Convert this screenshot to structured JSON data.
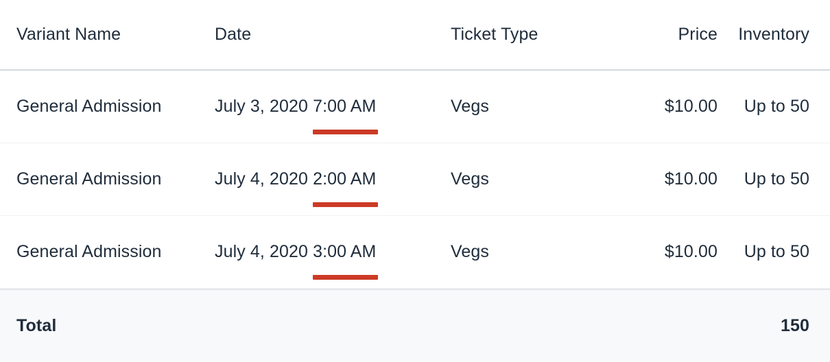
{
  "table": {
    "columns": [
      {
        "key": "variant_name",
        "label": "Variant Name",
        "align": "left"
      },
      {
        "key": "date",
        "label": "Date",
        "align": "left"
      },
      {
        "key": "ticket_type",
        "label": "Ticket Type",
        "align": "left"
      },
      {
        "key": "price",
        "label": "Price",
        "align": "right"
      },
      {
        "key": "inventory",
        "label": "Inventory",
        "align": "right"
      }
    ],
    "headers": {
      "variant_name": "Variant Name",
      "date": "Date",
      "ticket_type": "Ticket Type",
      "price": "Price",
      "inventory": "Inventory"
    },
    "rows": [
      {
        "variant_name": "General Admission",
        "date_day": "July 3, 2020 ",
        "date_time": "7:00 AM",
        "date_full": "July 3, 2020 7:00 AM",
        "ticket_type": "Vegs",
        "price": "$10.00",
        "inventory": "Up to 50",
        "time_highlighted": true
      },
      {
        "variant_name": "General Admission",
        "date_day": "July 4, 2020 ",
        "date_time": "2:00 AM",
        "date_full": "July 4, 2020 2:00 AM",
        "ticket_type": "Vegs",
        "price": "$10.00",
        "inventory": "Up to 50",
        "time_highlighted": true
      },
      {
        "variant_name": "General Admission",
        "date_day": "July 4, 2020 ",
        "date_time": "3:00 AM",
        "date_full": "July 4, 2020 3:00 AM",
        "ticket_type": "Vegs",
        "price": "$10.00",
        "inventory": "Up to 50",
        "time_highlighted": true
      }
    ],
    "footer": {
      "label": "Total",
      "value": "150"
    }
  },
  "colors": {
    "text": "#202d3c",
    "highlight_underline": "#cc3a26",
    "header_rule": "#d3d8e0",
    "row_rule": "#f1f2f4",
    "footer_background": "#f8f9fb",
    "page_background": "#ffffff"
  }
}
